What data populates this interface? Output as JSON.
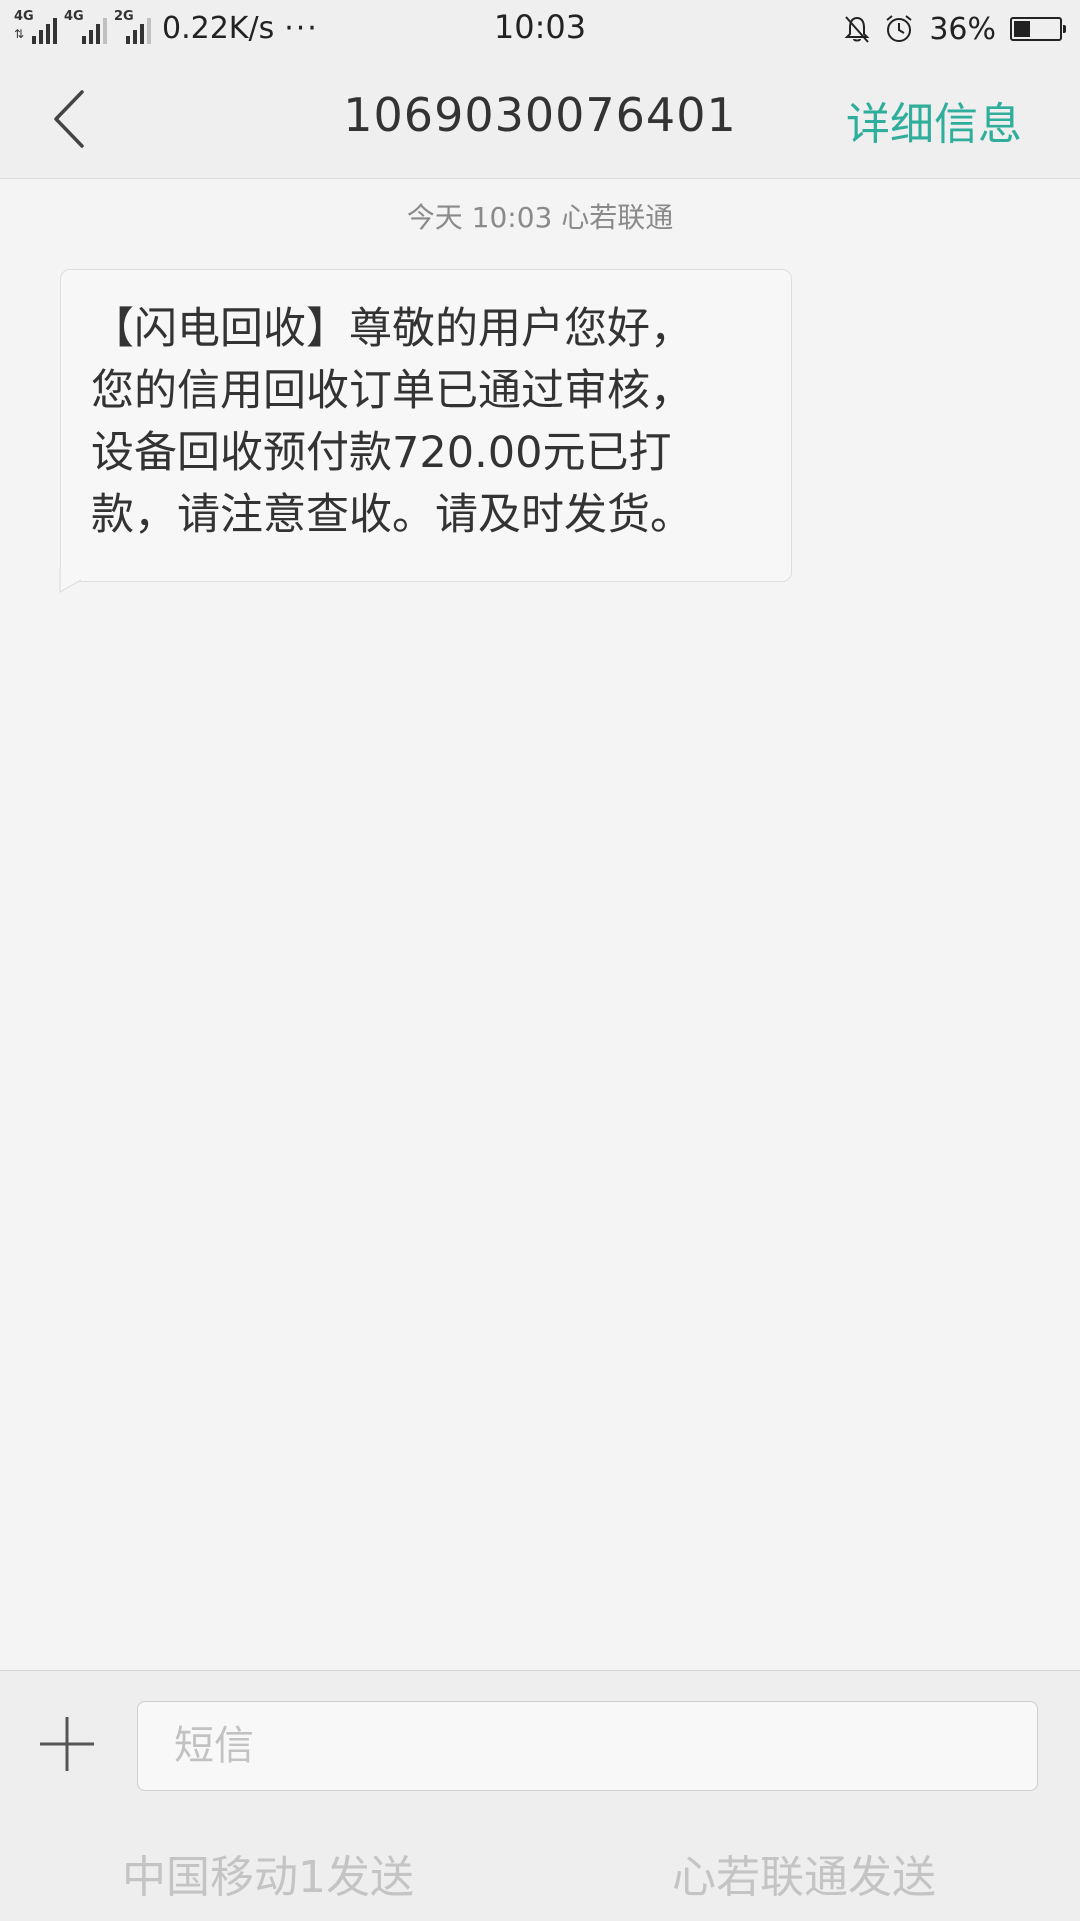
{
  "status_bar": {
    "signal1_label": "4G",
    "signal2_label": "4G",
    "signal3_label": "2G",
    "net_speed": "0.22K/s",
    "more_dots": "···",
    "time": "10:03",
    "battery_text": "36%",
    "battery_level": 0.36,
    "icons": [
      "mute-bell-icon",
      "alarm-clock-icon",
      "battery-icon"
    ]
  },
  "header": {
    "back_icon": "back-chevron-icon",
    "title": "1069030076401",
    "detail_label": "详细信息",
    "accent_color": "#2fae9c"
  },
  "conversation": {
    "timestamp": "今天  10:03  心若联通",
    "messages": [
      {
        "direction": "incoming",
        "text": "【闪电回收】尊敬的用户您好，\n您的信用回收订单已通过审核，\n设备回收预付款720.00元已打\n款，请注意查收。请及时发货。"
      }
    ]
  },
  "composer": {
    "add_icon": "plus-icon",
    "placeholder": "短信",
    "value": "",
    "send_sim1_label": "中国移动1发送",
    "send_sim2_label": "心若联通发送"
  }
}
